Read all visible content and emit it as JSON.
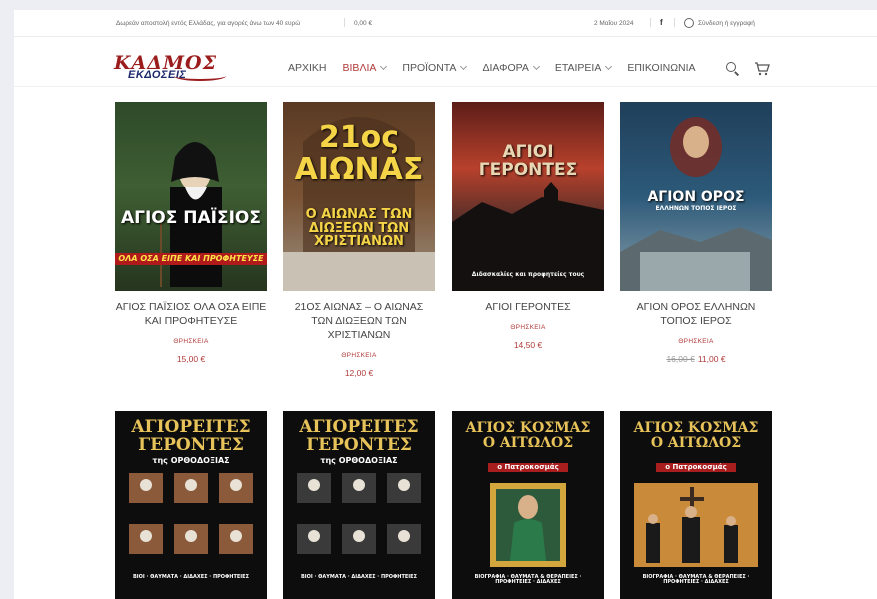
{
  "topbar": {
    "promo": "Δωρεάν αποστολή εντός Ελλάδας, για αγορές άνω των 40 ευρώ",
    "cart_total": "0,00 €",
    "date": "2 Μαΐου 2024",
    "facebook_glyph": "f",
    "login": "Σύνδεση ή εγγραφή"
  },
  "logo": {
    "brand": "ΚΑΔΜΟΣ",
    "sub": "ΕΚΔΟΣΕΙΣ"
  },
  "nav": [
    {
      "label": "ΑΡΧΙΚΗ",
      "dropdown": false,
      "active": false
    },
    {
      "label": "ΒΙΒΛΙΑ",
      "dropdown": true,
      "active": true
    },
    {
      "label": "ΠΡΟΪΟΝΤΑ",
      "dropdown": true,
      "active": false
    },
    {
      "label": "ΔΙΑΦΟΡΑ",
      "dropdown": true,
      "active": false
    },
    {
      "label": "ΕΤΑΙΡΕΙΑ",
      "dropdown": true,
      "active": false
    },
    {
      "label": "ΕΠΙΚΟΙΝΩΝΙΑ",
      "dropdown": false,
      "active": false
    }
  ],
  "colors": {
    "accent": "#b03a3a",
    "brand_red": "#9b1c1c",
    "brand_blue": "#1d2a6b"
  },
  "products": [
    {
      "cover_title": "ΑΓΙΟΣ ΠΑΪΣΙΟΣ",
      "cover_sub": "ΟΛΑ ΟΣΑ ΕΙΠΕ ΚΑΙ ΠΡΟΦΗΤΕΥΣΕ",
      "name": "ΑΓΙΟΣ ΠΑΪΣΙΟΣ ΟΛΑ ΟΣΑ ΕΙΠΕ ΚΑΙ ΠΡΟΦΗΤΕΥΣΕ",
      "category": "ΘΡΗΣΚΕΙΑ",
      "price": "15,00 €",
      "old_price": ""
    },
    {
      "cover_title": "21ος ΑΙΩΝΑΣ",
      "cover_sub": "Ο ΑΙΩΝΑΣ ΤΩΝ ΔΙΩΞΕΩΝ ΤΩΝ ΧΡΙΣΤΙΑΝΩΝ",
      "name": "21ΟΣ ΑΙΩΝΑΣ – Ο ΑΙΩΝΑΣ ΤΩΝ ΔΙΩΞΕΩΝ ΤΩΝ ΧΡΙΣΤΙΑΝΩΝ",
      "category": "ΘΡΗΣΚΕΙΑ",
      "price": "12,00 €",
      "old_price": ""
    },
    {
      "cover_title": "ΑΓΙΟΙ ΓΕΡΟΝΤΕΣ",
      "cover_sub": "Διδασκαλίες και προφητείες τους",
      "name": "ΑΓΙΟΙ ΓΕΡΟΝΤΕΣ",
      "category": "ΘΡΗΣΚΕΙΑ",
      "price": "14,50 €",
      "old_price": ""
    },
    {
      "cover_title": "ΑΓΙΟΝ ΟΡΟΣ",
      "cover_sub": "ΕΛΛΗΝΩΝ ΤΟΠΟΣ ΙΕΡΟΣ",
      "name": "ΑΓΙΟΝ ΟΡΟΣ ΕΛΛΗΝΩΝ ΤΟΠΟΣ ΙΕΡΟΣ",
      "category": "ΘΡΗΣΚΕΙΑ",
      "price": "11,00 €",
      "old_price": "16,00 €"
    },
    {
      "cover_title": "ΑΓΙΟΡΕΙΤΕΣ ΓΕΡΟΝΤΕΣ",
      "cover_sub": "της ΟΡΘΟΔΟΞΙΑΣ",
      "cover_foot": "ΒΙΟΙ · ΘΑΥΜΑΤΑ · ΔΙΔΑΧΕΣ · ΠΡΟΦΗΤΕΙΕΣ"
    },
    {
      "cover_title": "ΑΓΙΟΡΕΙΤΕΣ ΓΕΡΟΝΤΕΣ",
      "cover_sub": "της ΟΡΘΟΔΟΞΙΑΣ",
      "cover_foot": "ΒΙΟΙ · ΘΑΥΜΑΤΑ · ΔΙΔΑΧΕΣ · ΠΡΟΦΗΤΕΙΕΣ"
    },
    {
      "cover_title": "ΑΓΙΟΣ ΚΟΣΜΑΣ Ο ΑΙΤΩΛΟΣ",
      "cover_sub": "ο Πατροκοσμάς",
      "cover_foot": "ΒΙΟΓΡΑΦΙΑ · ΘΑΥΜΑΤΑ & ΘΕΡΑΠΕΙΕΣ · ΠΡΟΦΗΤΕΙΕΣ · ΔΙΔΑΧΕΣ"
    },
    {
      "cover_title": "ΑΓΙΟΣ ΚΟΣΜΑΣ Ο ΑΙΤΩΛΟΣ",
      "cover_sub": "ο Πατροκοσμάς",
      "cover_foot": "ΒΙΟΓΡΑΦΙΑ · ΘΑΥΜΑΤΑ & ΘΕΡΑΠΕΙΕΣ · ΠΡΟΦΗΤΕΙΕΣ · ΔΙΔΑΧΕΣ"
    }
  ]
}
